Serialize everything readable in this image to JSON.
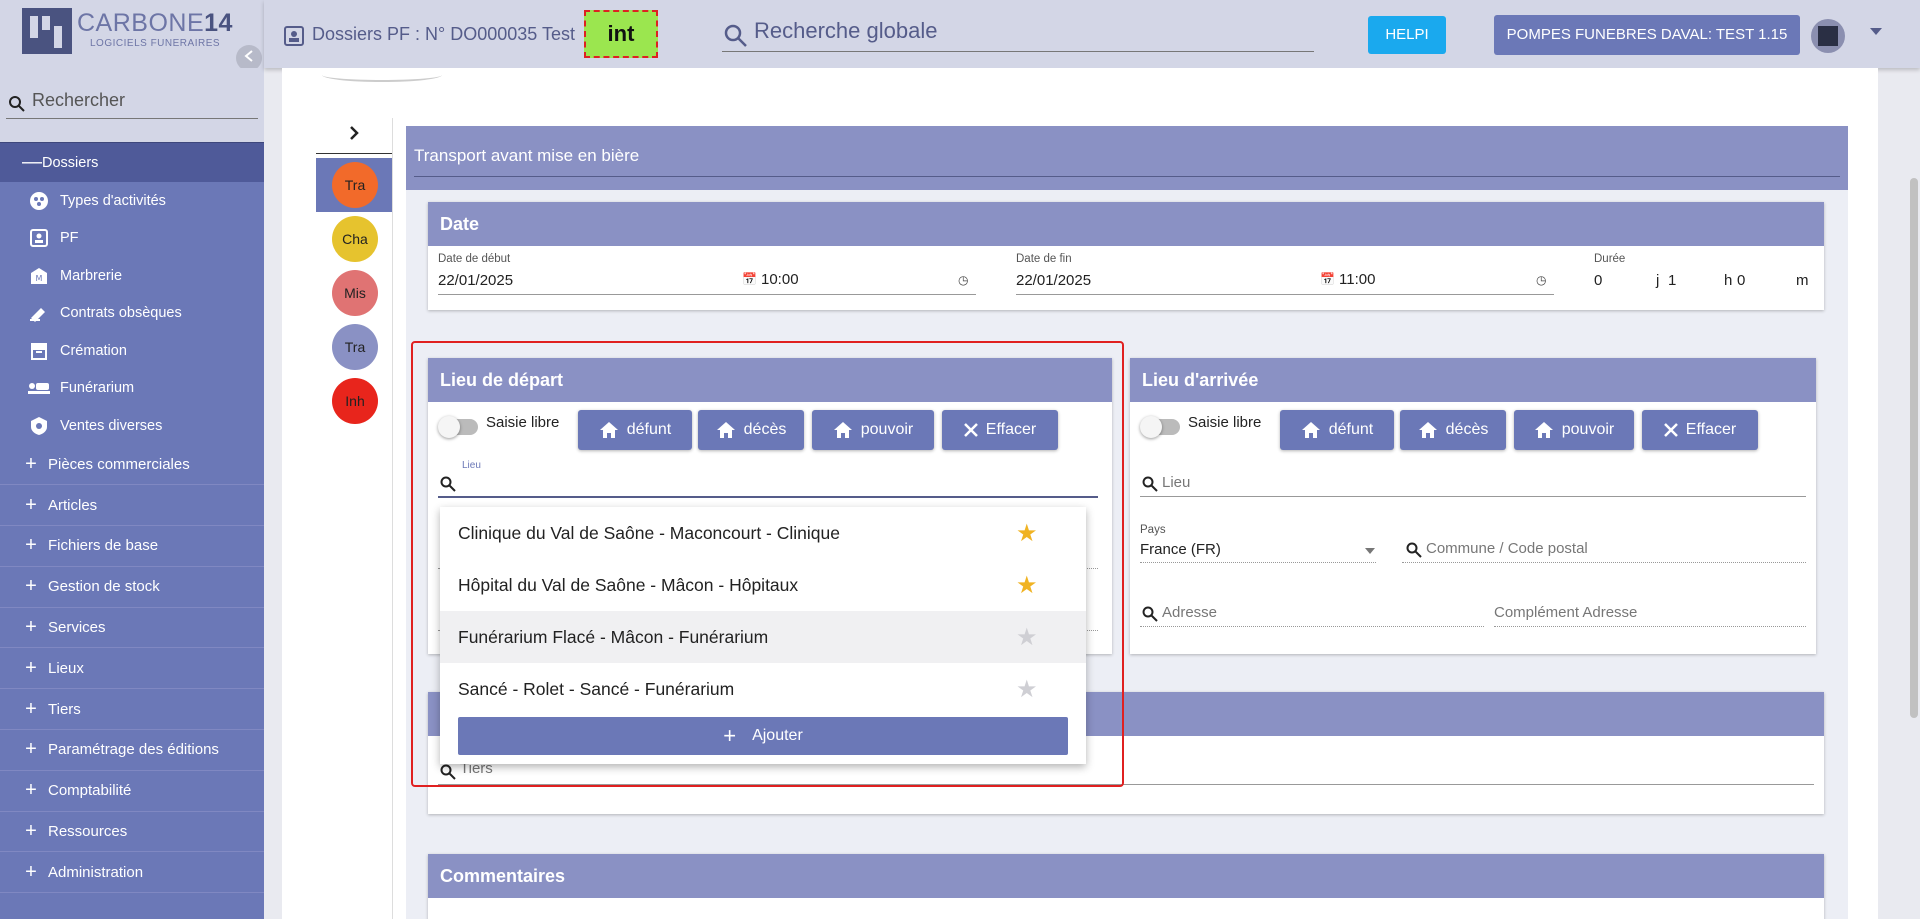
{
  "sidebar": {
    "logo_title_a": "CARBONE",
    "logo_title_b": "14",
    "logo_sub": "LOGICIELS FUNERAIRES",
    "search_placeholder": "Rechercher",
    "section_dossiers": "Dossiers",
    "dossiers_items": [
      {
        "label": "Types d'activités",
        "icon": "activity-types-icon"
      },
      {
        "label": "PF",
        "icon": "pf-icon"
      },
      {
        "label": "Marbrerie",
        "icon": "marbrerie-icon"
      },
      {
        "label": "Contrats obsèques",
        "icon": "contracts-icon"
      },
      {
        "label": "Crémation",
        "icon": "cremation-icon"
      },
      {
        "label": "Funérarium",
        "icon": "funerarium-icon"
      },
      {
        "label": "Ventes diverses",
        "icon": "sales-icon"
      }
    ],
    "items": [
      "Pièces commerciales",
      "Articles",
      "Fichiers de base",
      "Gestion de stock",
      "Services",
      "Lieux",
      "Tiers",
      "Paramétrage des éditions",
      "Comptabilité",
      "Ressources",
      "Administration"
    ]
  },
  "header": {
    "dossier_title": "Dossiers PF : N° DO000035 Test",
    "badge": "int",
    "global_search": "Recherche globale",
    "help_label": "HELPI",
    "company_label": "POMPES FUNEBRES DAVAL: TEST 1.15"
  },
  "tabs": [
    {
      "label": "Tra",
      "color": "#f26a2a"
    },
    {
      "label": "Cha",
      "color": "#e6c32e"
    },
    {
      "label": "Mis",
      "color": "#e07373"
    },
    {
      "label": "Tra",
      "color": "#8a91c4"
    },
    {
      "label": "Inh",
      "color": "#e8251c"
    }
  ],
  "form": {
    "section_title": "Transport avant mise en bière",
    "date_panel": {
      "title": "Date",
      "start_label": "Date de début",
      "start_date": "22/01/2025",
      "start_time": "10:00",
      "end_label": "Date de fin",
      "end_date": "22/01/2025",
      "end_time": "11:00",
      "duration_label": "Durée",
      "duration_days": "0",
      "days_unit": "j",
      "duration_hours": "1",
      "hours_unit": "h",
      "duration_minutes": "0",
      "minutes_unit": "m"
    },
    "departure": {
      "title": "Lieu de départ",
      "free_input_label": "Saisie libre",
      "btn_defunt": "défunt",
      "btn_deces": "décès",
      "btn_pouvoir": "pouvoir",
      "btn_clear": "Effacer",
      "lieu_label": "Lieu"
    },
    "arrival": {
      "title": "Lieu d'arrivée",
      "free_input_label": "Saisie libre",
      "btn_defunt": "défunt",
      "btn_deces": "décès",
      "btn_pouvoir": "pouvoir",
      "btn_clear": "Effacer",
      "lieu_placeholder": "Lieu",
      "country_label": "Pays",
      "country_value": "France (FR)",
      "commune_placeholder": "Commune / Code postal",
      "address_placeholder": "Adresse",
      "address_extra_placeholder": "Complément Adresse"
    },
    "tiers_placeholder": "Tiers",
    "comments_title": "Commentaires"
  },
  "dropdown": {
    "items": [
      {
        "label": "Clinique du Val de Saône - Maconcourt - Clinique",
        "favorite": true
      },
      {
        "label": "Hôpital du Val de Saône - Mâcon - Hôpitaux",
        "favorite": true
      },
      {
        "label": "Funérarium Flacé - Mâcon - Funérarium",
        "favorite": false
      },
      {
        "label": "Sancé - Rolet - Sancé - Funérarium",
        "favorite": false
      }
    ],
    "add_label": "Ajouter"
  },
  "colors": {
    "sidebar": "#6b78b7",
    "panel_header": "#8a91c4",
    "accent_help": "#1aa9ee",
    "star_active": "#f0b323",
    "star_inactive": "#cfcfd4"
  }
}
